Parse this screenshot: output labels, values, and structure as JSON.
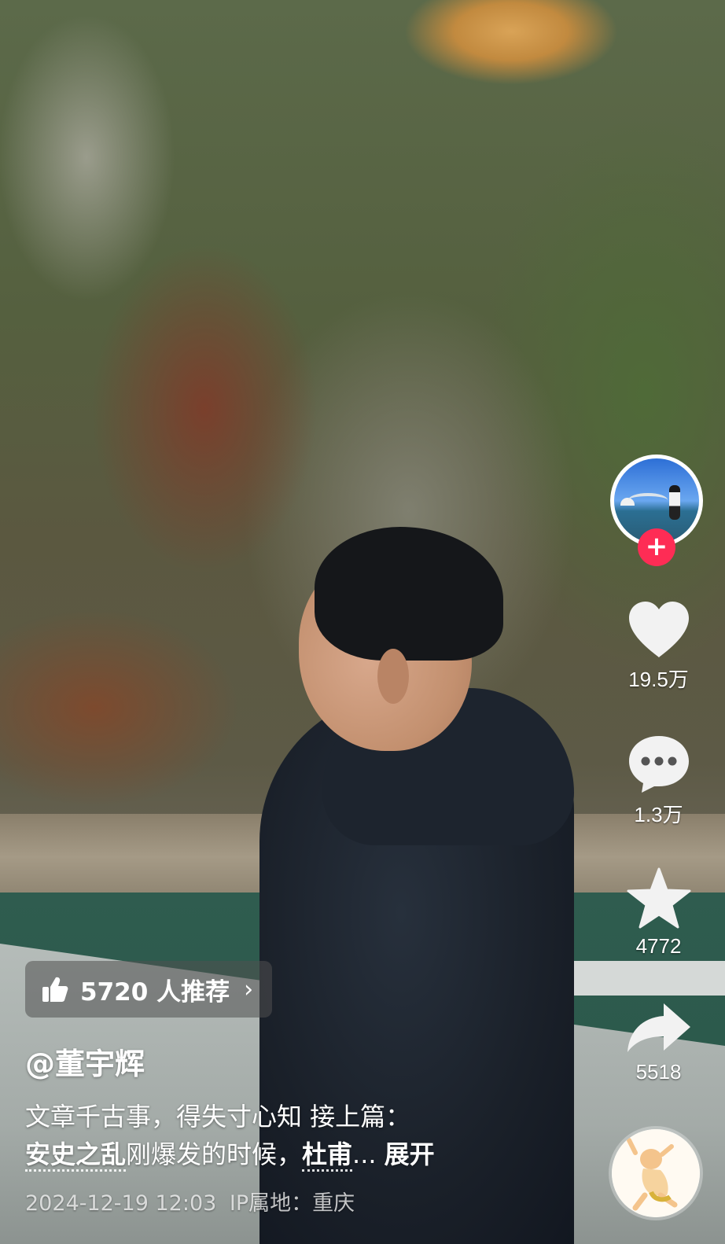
{
  "video": {
    "scene": "mountain-river-man-in-black-coat"
  },
  "creator": {
    "avatar_icon": "avatar",
    "follow_label": "+"
  },
  "actions": {
    "like_count": "19.5万",
    "comment_count": "1.3万",
    "favorite_count": "4772",
    "share_count": "5518"
  },
  "recommend": {
    "text": "5720 人推荐",
    "chevron": "›"
  },
  "post": {
    "author": "@董宇辉",
    "line1": "文章千古事，得失寸心知 接上篇：",
    "keyword1": "安史之乱",
    "middle": "刚爆发的时候，",
    "keyword2": "杜甫",
    "ellipsis": "...",
    "expand": "展开",
    "timestamp": "2024-12-19 12:03",
    "ip_location": "IP属地：重庆"
  },
  "colors": {
    "accent": "#fe2c55",
    "text": "#ffffff"
  }
}
